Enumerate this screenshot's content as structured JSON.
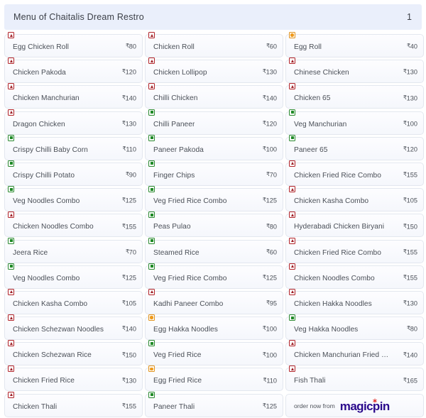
{
  "header": {
    "title": "Menu of Chaitalis Dream Restro",
    "page_number": "1"
  },
  "currency_symbol": "₹",
  "diet_colors": {
    "non_veg": "#b3262c",
    "veg": "#2e8b33",
    "egg": "#e2941f"
  },
  "columns": [
    {
      "items": [
        {
          "name": "Egg Chicken Roll",
          "price": "80",
          "diet": "non-veg"
        },
        {
          "name": "Chicken Pakoda",
          "price": "120",
          "diet": "non-veg"
        },
        {
          "name": "Chicken Manchurian",
          "price": "140",
          "diet": "non-veg"
        },
        {
          "name": "Dragon Chicken",
          "price": "130",
          "diet": "non-veg"
        },
        {
          "name": "Crispy Chilli Baby Corn",
          "price": "110",
          "diet": "veg"
        },
        {
          "name": "Crispy Chilli Potato",
          "price": "90",
          "diet": "veg"
        },
        {
          "name": "Veg Noodles Combo",
          "price": "125",
          "diet": "veg"
        },
        {
          "name": "Chicken Noodles Combo",
          "price": "155",
          "diet": "non-veg"
        },
        {
          "name": "Jeera Rice",
          "price": "70",
          "diet": "veg"
        },
        {
          "name": "Veg Noodles Combo",
          "price": "125",
          "diet": "veg"
        },
        {
          "name": "Chicken Kasha Combo",
          "price": "105",
          "diet": "non-veg"
        },
        {
          "name": "Chicken Schezwan Noodles",
          "price": "140",
          "diet": "non-veg"
        },
        {
          "name": "Chicken Schezwan Rice",
          "price": "150",
          "diet": "non-veg"
        },
        {
          "name": "Chicken Fried Rice",
          "price": "130",
          "diet": "non-veg"
        },
        {
          "name": "Chicken Thali",
          "price": "155",
          "diet": "non-veg"
        }
      ]
    },
    {
      "items": [
        {
          "name": "Chicken Roll",
          "price": "60",
          "diet": "non-veg"
        },
        {
          "name": "Chicken Lollipop",
          "price": "130",
          "diet": "non-veg"
        },
        {
          "name": "Chilli Chicken",
          "price": "140",
          "diet": "non-veg"
        },
        {
          "name": "Chilli Paneer",
          "price": "120",
          "diet": "veg"
        },
        {
          "name": "Paneer Pakoda",
          "price": "100",
          "diet": "veg"
        },
        {
          "name": "Finger Chips",
          "price": "70",
          "diet": "veg"
        },
        {
          "name": "Veg Fried Rice Combo",
          "price": "125",
          "diet": "veg"
        },
        {
          "name": "Peas Pulao",
          "price": "80",
          "diet": "veg"
        },
        {
          "name": "Steamed Rice",
          "price": "60",
          "diet": "veg"
        },
        {
          "name": "Veg Fried Rice Combo",
          "price": "125",
          "diet": "veg"
        },
        {
          "name": "Kadhi Paneer Combo",
          "price": "95",
          "diet": "non-veg"
        },
        {
          "name": "Egg Hakka Noodles",
          "price": "100",
          "diet": "egg"
        },
        {
          "name": "Veg Fried Rice",
          "price": "100",
          "diet": "veg"
        },
        {
          "name": "Egg Fried Rice",
          "price": "110",
          "diet": "egg"
        },
        {
          "name": "Paneer Thali",
          "price": "125",
          "diet": "veg"
        }
      ]
    },
    {
      "items": [
        {
          "name": "Egg Roll",
          "price": "40",
          "diet": "egg"
        },
        {
          "name": "Chinese Chicken",
          "price": "130",
          "diet": "non-veg"
        },
        {
          "name": "Chicken 65",
          "price": "130",
          "diet": "non-veg"
        },
        {
          "name": "Veg Manchurian",
          "price": "100",
          "diet": "veg"
        },
        {
          "name": "Paneer 65",
          "price": "120",
          "diet": "veg"
        },
        {
          "name": "Chicken Fried Rice Combo",
          "price": "155",
          "diet": "non-veg"
        },
        {
          "name": "Chicken Kasha Combo",
          "price": "105",
          "diet": "non-veg"
        },
        {
          "name": "Hyderabadi Chicken Biryani",
          "price": "150",
          "diet": "non-veg"
        },
        {
          "name": "Chicken Fried Rice Combo",
          "price": "155",
          "diet": "non-veg"
        },
        {
          "name": "Chicken Noodles Combo",
          "price": "155",
          "diet": "non-veg"
        },
        {
          "name": "Chicken Hakka Noodles",
          "price": "130",
          "diet": "non-veg"
        },
        {
          "name": "Veg Hakka Noodles",
          "price": "80",
          "diet": "veg"
        },
        {
          "name": "Chicken Manchurian Fried Rice",
          "price": "140",
          "diet": "non-veg"
        },
        {
          "name": "Fish Thali",
          "price": "165",
          "diet": "non-veg"
        }
      ]
    }
  ],
  "promo": {
    "text": "order now from",
    "brand": "magicpin",
    "star": "✶"
  }
}
